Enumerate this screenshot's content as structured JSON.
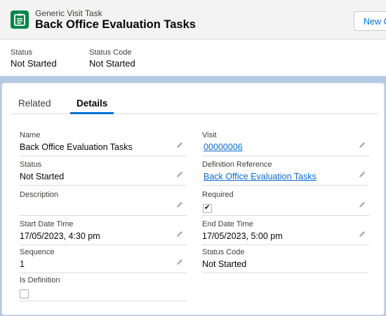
{
  "header": {
    "object_type": "Generic Visit Task",
    "title": "Back Office Evaluation Tasks",
    "new_button_label": "New C",
    "highlights": [
      {
        "label": "Status",
        "value": "Not Started"
      },
      {
        "label": "Status Code",
        "value": "Not Started"
      }
    ]
  },
  "tabs": [
    {
      "label": "Related",
      "active": false
    },
    {
      "label": "Details",
      "active": true
    }
  ],
  "details": {
    "name": {
      "label": "Name",
      "value": "Back Office Evaluation Tasks"
    },
    "visit": {
      "label": "Visit",
      "value": "00000006"
    },
    "status": {
      "label": "Status",
      "value": "Not Started"
    },
    "definition_reference": {
      "label": "Definition Reference",
      "value": "Back Office Evaluation Tasks"
    },
    "description": {
      "label": "Description",
      "value": ""
    },
    "required": {
      "label": "Required",
      "checked": true
    },
    "start_date_time": {
      "label": "Start Date Time",
      "value": "17/05/2023, 4:30 pm"
    },
    "end_date_time": {
      "label": "End Date Time",
      "value": "17/05/2023, 5:00 pm"
    },
    "sequence": {
      "label": "Sequence",
      "value": "1"
    },
    "status_code": {
      "label": "Status Code",
      "value": "Not Started"
    },
    "is_definition": {
      "label": "Is Definition",
      "checked": false
    }
  },
  "colors": {
    "brand_icon": "#04844b",
    "link": "#0b6ad1",
    "tab_accent": "#0070d2",
    "page_background": "#b6c9e2"
  },
  "icons": [
    "task-list-icon",
    "pencil-edit-icon",
    "checkmark-icon"
  ]
}
